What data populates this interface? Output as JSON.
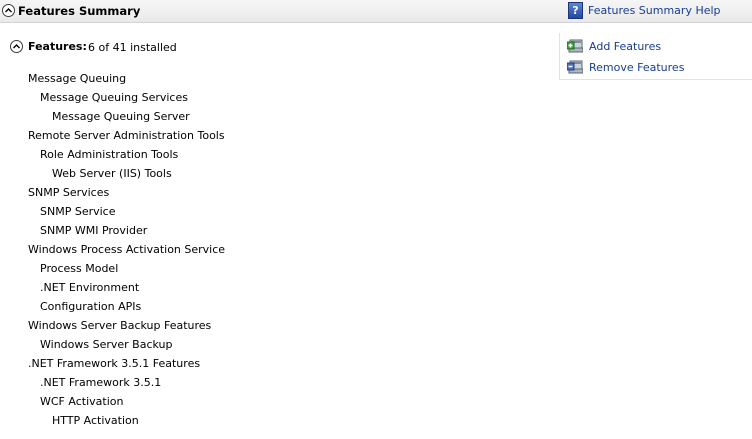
{
  "header": {
    "title": "Features Summary",
    "help_link": "Features Summary Help",
    "help_icon": "?"
  },
  "features": {
    "label": "Features:",
    "count": "6 of 41 installed"
  },
  "actions": {
    "add": "Add Features",
    "remove": "Remove Features"
  },
  "tree": [
    {
      "label": "Message Queuing",
      "level": 0
    },
    {
      "label": "Message Queuing Services",
      "level": 1
    },
    {
      "label": "Message Queuing Server",
      "level": 2
    },
    {
      "label": "Remote Server Administration Tools",
      "level": 0
    },
    {
      "label": "Role Administration Tools",
      "level": 1
    },
    {
      "label": "Web Server (IIS) Tools",
      "level": 2
    },
    {
      "label": "SNMP Services",
      "level": 0
    },
    {
      "label": "SNMP Service",
      "level": 1
    },
    {
      "label": "SNMP WMI Provider",
      "level": 1
    },
    {
      "label": "Windows Process Activation Service",
      "level": 0
    },
    {
      "label": "Process Model",
      "level": 1
    },
    {
      "label": ".NET Environment",
      "level": 1
    },
    {
      "label": "Configuration APIs",
      "level": 1
    },
    {
      "label": "Windows Server Backup Features",
      "level": 0
    },
    {
      "label": "Windows Server Backup",
      "level": 1
    },
    {
      "label": ".NET Framework 3.5.1 Features",
      "level": 0
    },
    {
      "label": ".NET Framework 3.5.1",
      "level": 1
    },
    {
      "label": "WCF Activation",
      "level": 1
    },
    {
      "label": "HTTP Activation",
      "level": 2
    }
  ]
}
